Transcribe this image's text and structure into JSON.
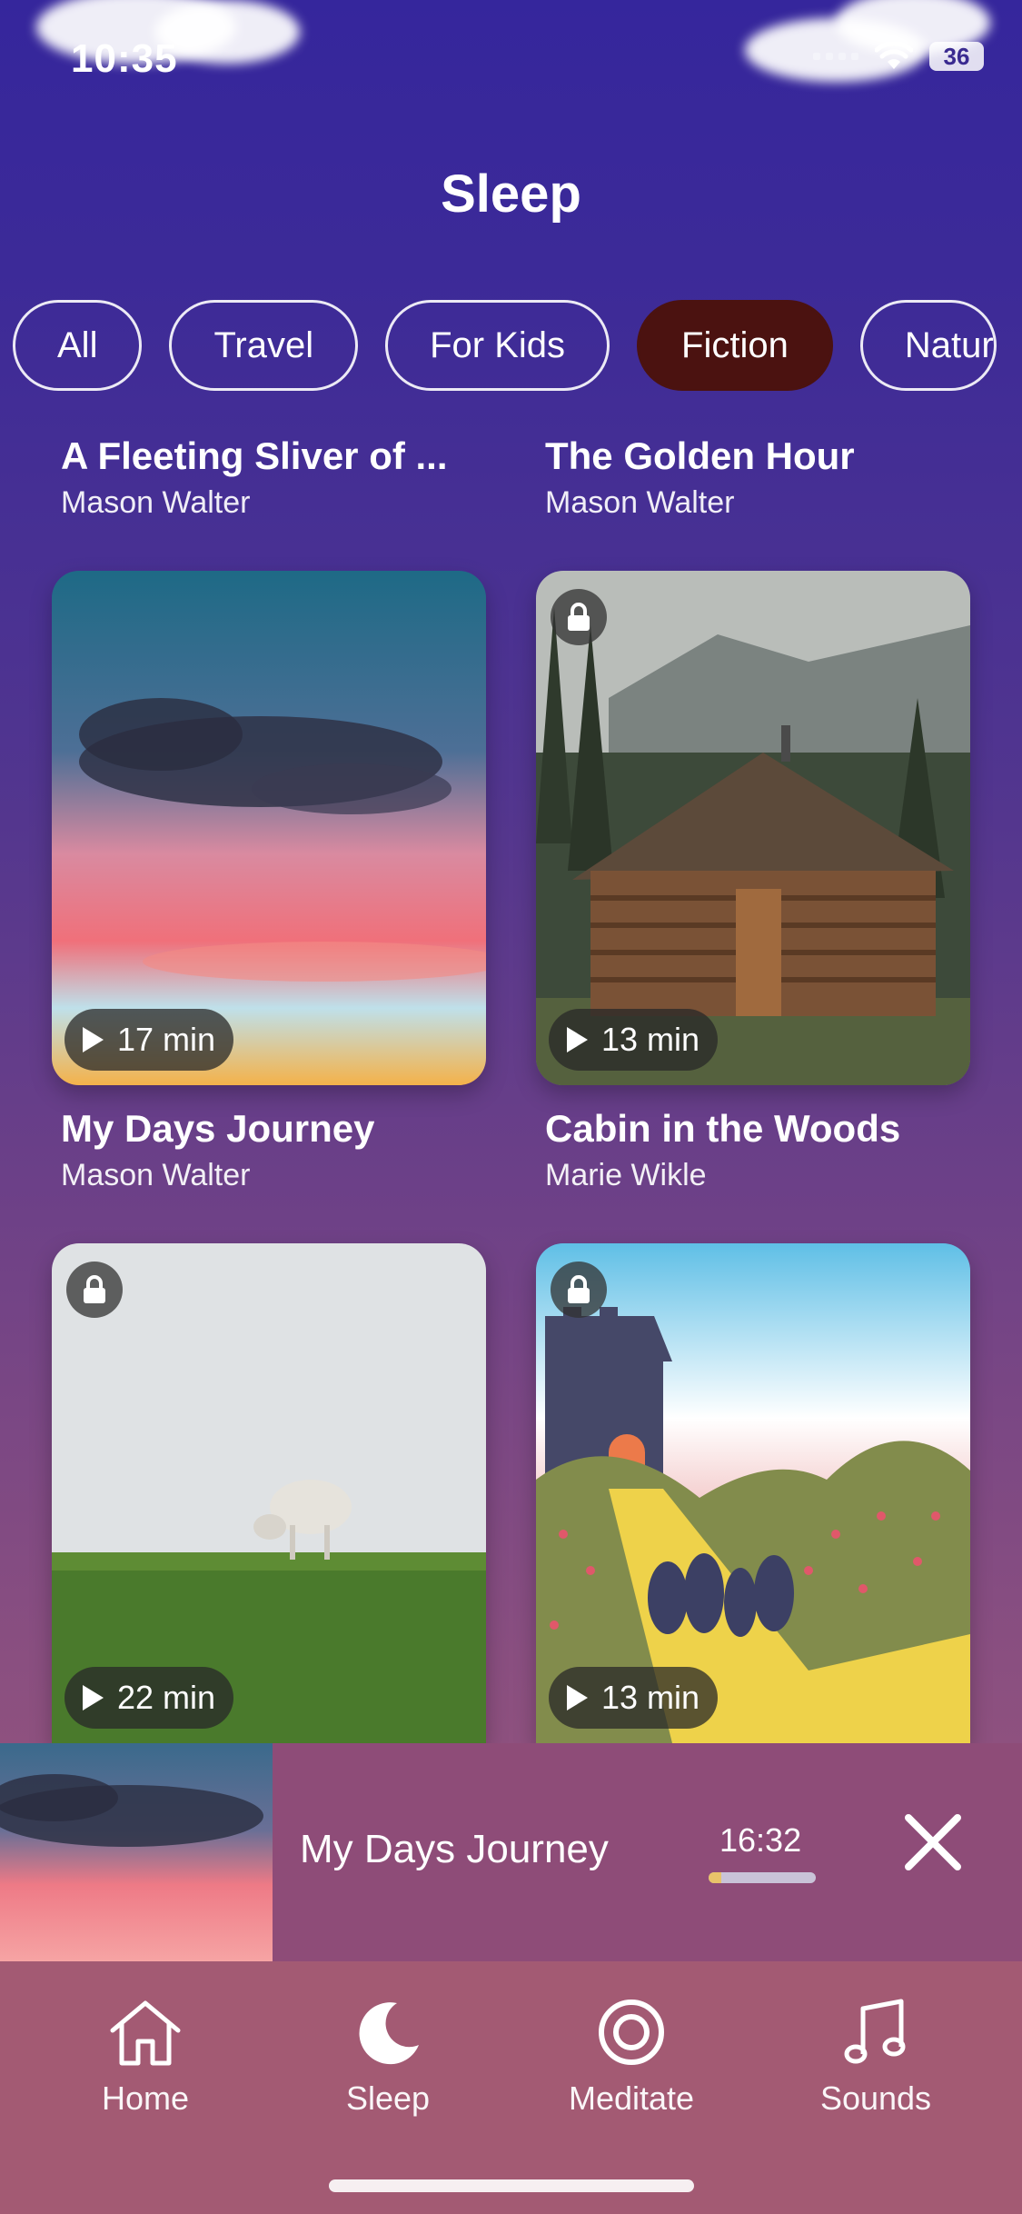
{
  "status_bar": {
    "time": "10:35",
    "battery": "36"
  },
  "header": {
    "title": "Sleep"
  },
  "categories": [
    {
      "label": "All",
      "active": false
    },
    {
      "label": "Travel",
      "active": false
    },
    {
      "label": "For Kids",
      "active": false
    },
    {
      "label": "Fiction",
      "active": true
    },
    {
      "label": "Natur",
      "active": false
    }
  ],
  "stories": [
    {
      "title": "A Fleeting Sliver of ...",
      "author": "Mason Walter"
    },
    {
      "title": "The Golden Hour",
      "author": "Mason Walter"
    },
    {
      "title": "My Days Journey",
      "author": "Mason Walter",
      "duration": "17 min",
      "locked": false
    },
    {
      "title": "Cabin in the Woods",
      "author": "Marie Wikle",
      "duration": "13 min",
      "locked": true
    },
    {
      "duration": "22 min",
      "locked": true
    },
    {
      "duration": "13 min",
      "locked": true
    }
  ],
  "player": {
    "title": "My Days Journey",
    "time": "16:32",
    "progress": 0.12
  },
  "tabs": [
    {
      "label": "Home",
      "icon": "home-icon"
    },
    {
      "label": "Sleep",
      "icon": "moon-icon",
      "active": true
    },
    {
      "label": "Meditate",
      "icon": "target-icon"
    },
    {
      "label": "Sounds",
      "icon": "music-note-icon"
    }
  ],
  "colors": {
    "active_chip": "#4b1210",
    "progress_fill": "#e8c36a",
    "tab_bar": "#a35a73",
    "player_bg": "#8e4c78"
  }
}
